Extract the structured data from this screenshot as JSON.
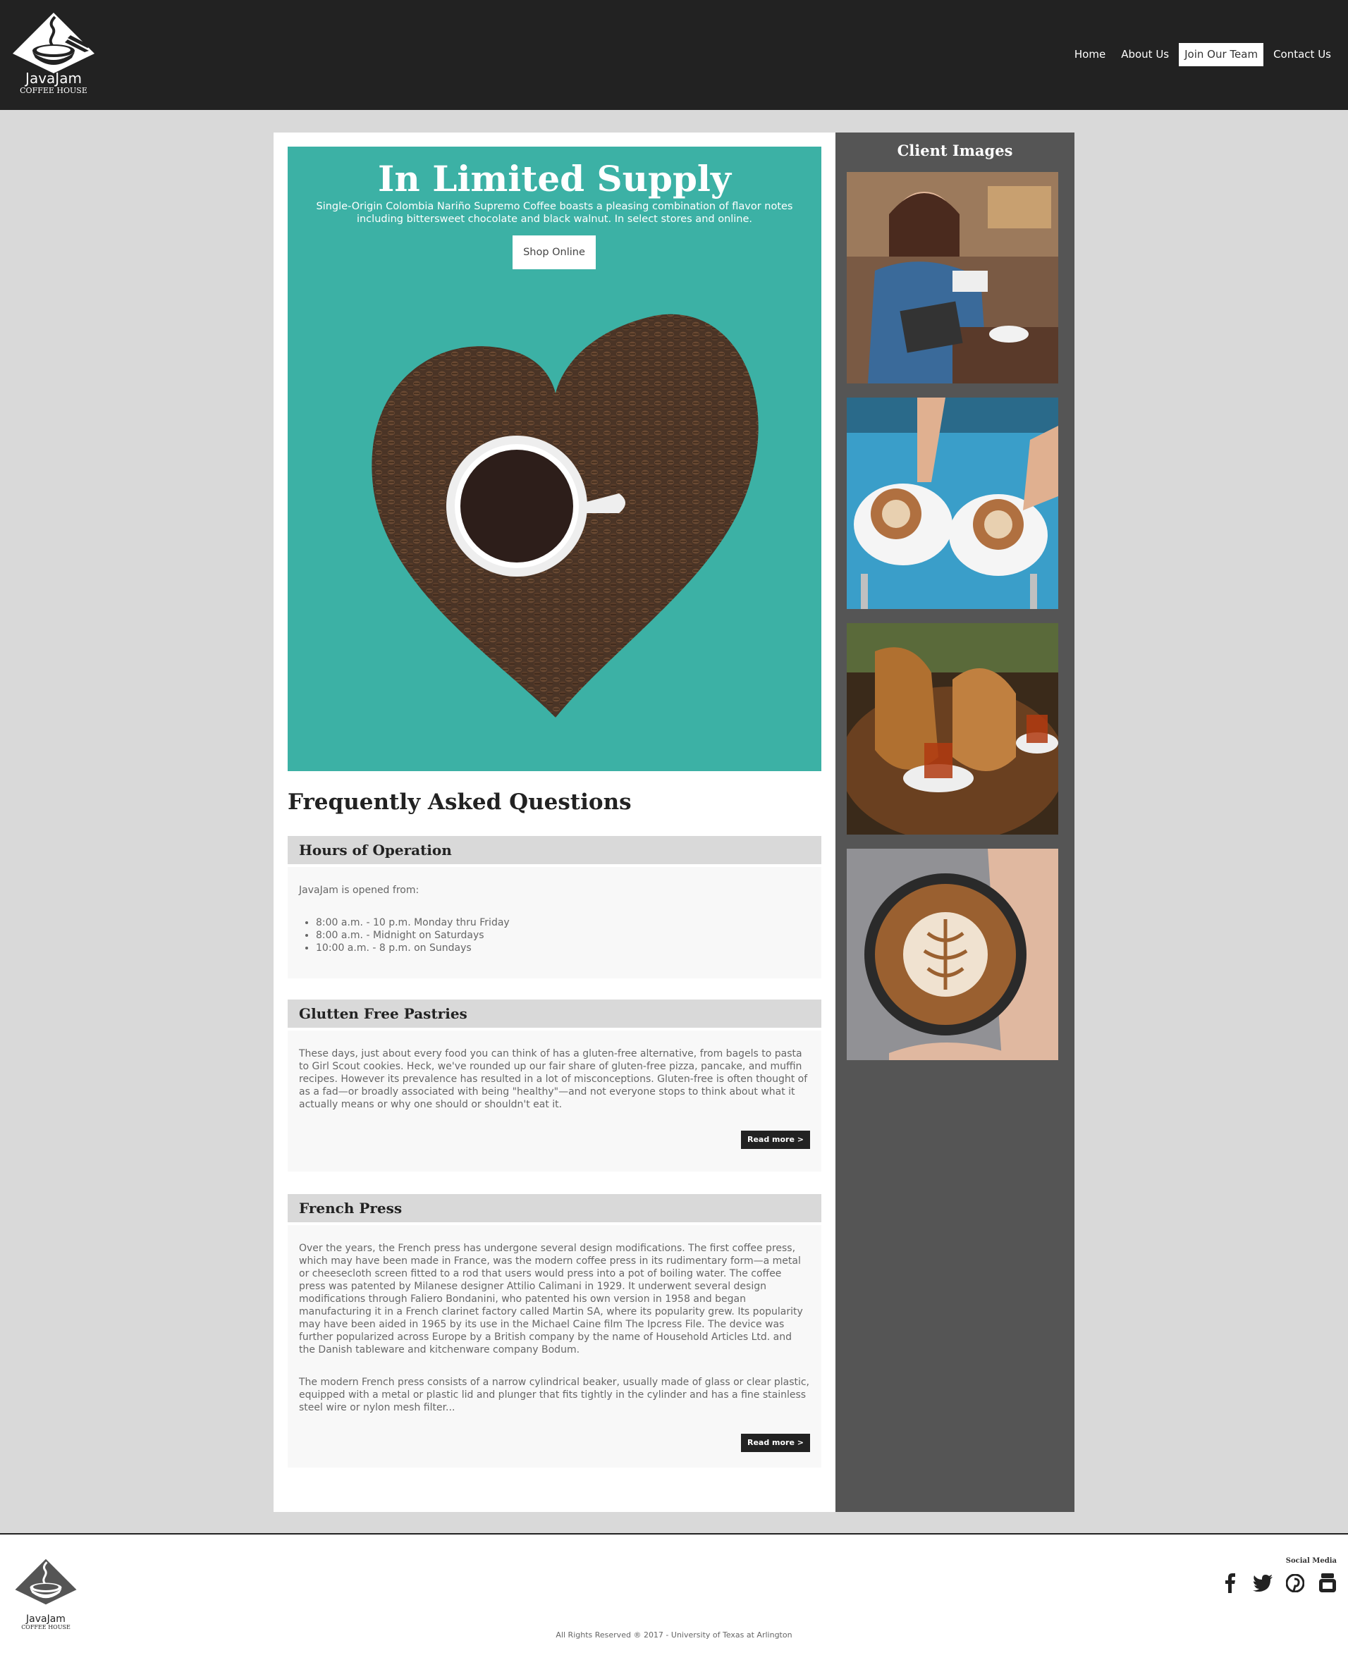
{
  "header": {
    "logo_name": "JavaJam",
    "logo_sub": "COFFEE HOUSE",
    "nav": [
      {
        "label": "Home"
      },
      {
        "label": "About Us"
      },
      {
        "label": "Join Our Team"
      },
      {
        "label": "Contact Us"
      }
    ]
  },
  "hero": {
    "title": "In Limited Supply",
    "text": "Single-Origin Colombia Nariño Supremo Coffee boasts a pleasing combination of flavor notes including bittersweet chocolate and black walnut. In select stores and online.",
    "button": "Shop Online",
    "bg_color": "#3cb1a5"
  },
  "faq": {
    "title": "Frequently Asked Questions",
    "items": [
      {
        "heading": "Hours of Operation",
        "intro": "JavaJam is opened from:",
        "list": [
          "8:00 a.m. - 10 p.m. Monday thru Friday",
          "8:00 a.m. - Midnight on Saturdays",
          "10:00 a.m. - 8 p.m. on Sundays"
        ]
      },
      {
        "heading": "Glutten Free Pastries",
        "paragraphs": [
          "These days, just about every food you can think of has a gluten-free alternative, from bagels to pasta to Girl Scout cookies. Heck, we've rounded up our fair share of gluten-free pizza, pancake, and muffin recipes. However its prevalence has resulted in a lot of misconceptions. Gluten-free is often thought of as a fad—or broadly associated with being \"healthy\"—and not everyone stops to think about what it actually means or why one should or shouldn't eat it."
        ],
        "button": "Read more >"
      },
      {
        "heading": "French Press",
        "paragraphs": [
          "Over the years, the French press has undergone several design modifications. The first coffee press, which may have been made in France, was the modern coffee press in its rudimentary form—a metal or cheesecloth screen fitted to a rod that users would press into a pot of boiling water. The coffee press was patented by Milanese designer Attilio Calimani in 1929. It underwent several design modifications through Faliero Bondanini, who patented his own version in 1958 and began manufacturing it in a French clarinet factory called Martin SA, where its popularity grew. Its popularity may have been aided in 1965 by its use in the Michael Caine film The Ipcress File. The device was further popularized across Europe by a British company by the name of Household Articles Ltd. and the Danish tableware and kitchenware company Bodum.",
          "The modern French press consists of a narrow cylindrical beaker, usually made of glass or clear plastic, equipped with a metal or plastic lid and plunger that fits tightly in the cylinder and has a fine stainless steel wire or nylon mesh filter..."
        ],
        "button": "Read more >"
      }
    ]
  },
  "sidebar": {
    "title": "Client Images",
    "images": [
      "woman-paying-card-photo",
      "two-cappuccinos-photo",
      "turkish-tea-photo",
      "latte-art-photo"
    ]
  },
  "footer": {
    "logo_name": "JavaJam",
    "logo_sub": "COFFEE HOUSE",
    "social_label": "Social Media",
    "social_icons": [
      "facebook-icon",
      "twitter-icon",
      "pinterest-icon",
      "youtube-icon"
    ],
    "copyright": "All Rights Reserved ® 2017 - University of Texas at Arlington"
  }
}
